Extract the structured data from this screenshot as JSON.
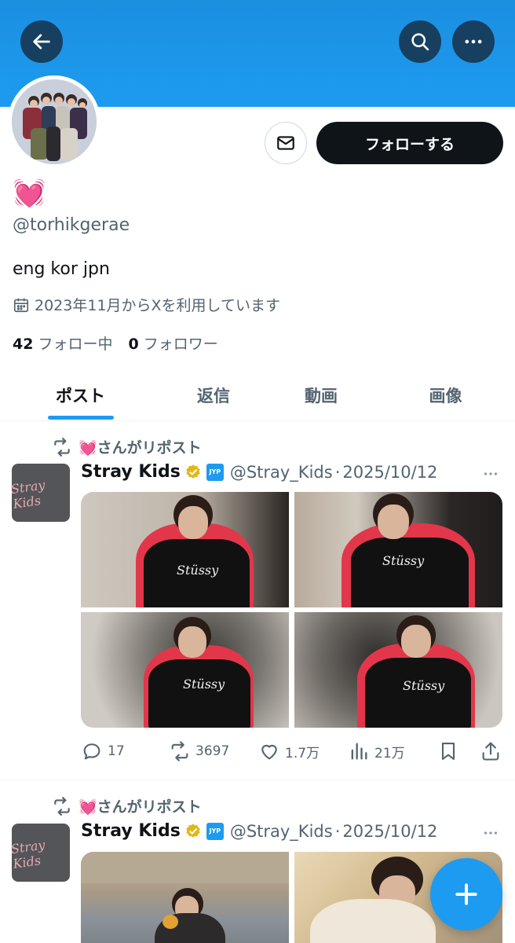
{
  "header": {
    "back_icon": "arrow-left-icon",
    "search_icon": "search-icon",
    "more_icon": "more-horizontal-icon",
    "banner_color": "#1d9bf0"
  },
  "profile": {
    "display_name": "💓",
    "handle": "@torhikgerae",
    "bio": "eng kor jpn",
    "joined": "2023年11月からXを利用しています",
    "following_count": "42",
    "following_label": "フォロー中",
    "followers_count": "0",
    "followers_label": "フォロワー",
    "follow_button": "フォローする"
  },
  "tabs": [
    {
      "label": "ポスト",
      "active": true
    },
    {
      "label": "返信",
      "active": false
    },
    {
      "label": "動画",
      "active": false
    },
    {
      "label": "画像",
      "active": false
    }
  ],
  "posts": [
    {
      "repost_label": "💓さんがリポスト",
      "author_name": "Stray Kids",
      "author_handle": "@Stray_Kids",
      "separator": "·",
      "date": "2025/10/12",
      "avatar_text": "Stray Kids",
      "badge_text": "JYP",
      "replies": "17",
      "reposts": "3697",
      "likes": "1.7万",
      "views": "21万"
    },
    {
      "repost_label": "💓さんがリポスト",
      "author_name": "Stray Kids",
      "author_handle": "@Stray_Kids",
      "separator": "·",
      "date": "2025/10/12",
      "avatar_text": "Stray Kids",
      "badge_text": "JYP"
    }
  ],
  "colors": {
    "accent": "#1d9bf0",
    "text": "#0f1419",
    "secondary": "#536471",
    "verified_gold": "#e2b719"
  }
}
